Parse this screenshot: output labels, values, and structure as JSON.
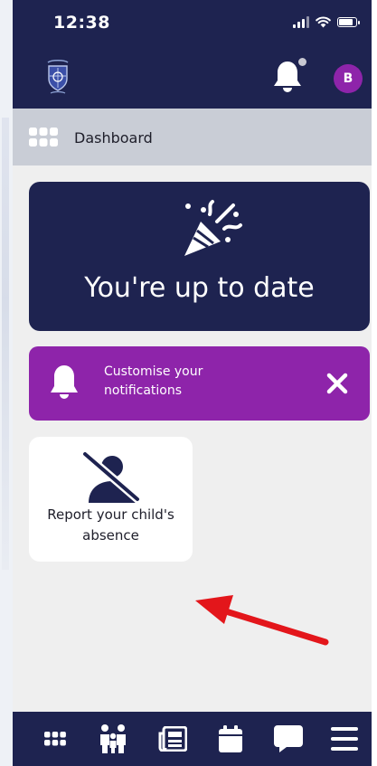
{
  "status_bar": {
    "time": "12:38"
  },
  "header": {
    "avatar_initial": "B",
    "crest_icon": "school-crest-icon",
    "bell_icon": "bell-icon"
  },
  "breadcrumb": {
    "label": "Dashboard",
    "icon": "grid-icon"
  },
  "up_to_date_card": {
    "text": "You're up to date",
    "icon": "party-popper-icon"
  },
  "notifications_card": {
    "text": "Customise your notifications",
    "icon": "bell-icon",
    "close_icon": "close-icon"
  },
  "absence_card": {
    "text": "Report your child's absence",
    "icon": "person-off-icon"
  },
  "bottom_nav": {
    "items": [
      {
        "icon": "grid-icon"
      },
      {
        "icon": "family-icon"
      },
      {
        "icon": "news-icon"
      },
      {
        "icon": "calendar-icon"
      },
      {
        "icon": "chat-icon"
      },
      {
        "icon": "menu-icon"
      }
    ]
  },
  "colors": {
    "navy": "#1e2350",
    "purple": "#8e24aa",
    "background": "#efefef",
    "breadcrumb_bg": "#c9cdd6",
    "arrow": "#e3161b"
  }
}
